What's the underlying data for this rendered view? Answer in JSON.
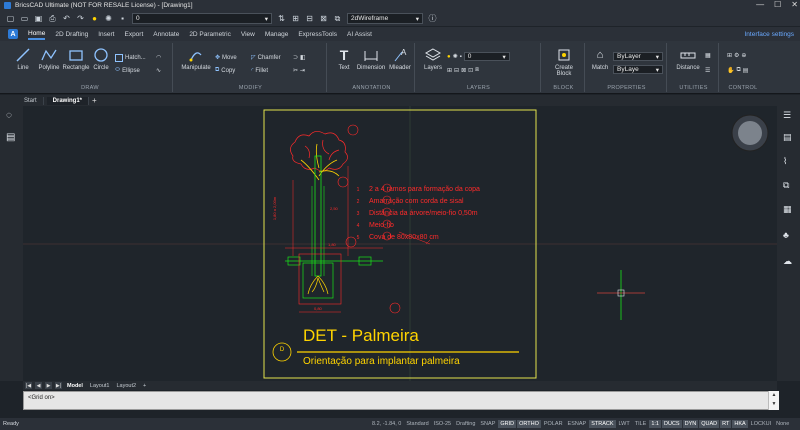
{
  "window": {
    "title": "BricsCAD Ultimate (NOT FOR RESALE License) - [Drawing1]",
    "controls": [
      "—",
      "☐",
      "✕"
    ]
  },
  "qat": {
    "layer_value": "0",
    "visual_style": "2dWireframe"
  },
  "tabs": [
    "Home",
    "2D Drafting",
    "Insert",
    "Export",
    "Annotate",
    "2D Parametric",
    "View",
    "Manage",
    "ExpressTools",
    "AI Assist"
  ],
  "interface_settings": "Interface settings",
  "ribbon": {
    "draw": {
      "title": "DRAW",
      "line": "Line",
      "polyline": "Polyline",
      "rectangle": "Rectangle",
      "circle": "Circle",
      "hatch": "Hatch...",
      "ellipse": "Ellipse"
    },
    "modify": {
      "title": "MODIFY",
      "manipulate": "Manipulate",
      "move": "Move",
      "copy": "Copy",
      "chamfer": "Chamfer",
      "fillet": "Fillet"
    },
    "annotation": {
      "title": "ANNOTATION",
      "text": "Text",
      "dimension": "Dimension",
      "mleader": "Mleader"
    },
    "layers": {
      "title": "LAYERS",
      "layers": "Layers",
      "layer_value": "0"
    },
    "block": {
      "title": "BLOCK",
      "create": "Create",
      "block": "Block"
    },
    "properties": {
      "title": "PROPERTIES",
      "match": "Match",
      "color": "ByLayer",
      "linetype": "ByLaye"
    },
    "utilities": {
      "title": "UTILITIES",
      "distance": "Distance"
    },
    "control": {
      "title": "CONTROL"
    }
  },
  "doc_tabs": [
    "Start",
    "Drawing1*"
  ],
  "drawing": {
    "notes": [
      "2 a 4 ramos para formação da copa",
      "Amarração com corda de sisal",
      "Distância da árvore/meio-fio 0,50m",
      "Meio-fio",
      "Cova de 80x80x80 cm"
    ],
    "note_numbers": [
      "1",
      "2",
      "3",
      "4",
      "5"
    ],
    "detail_title": "DET - Palmeira",
    "detail_subtitle": "Orientação para implantar palmeira",
    "detail_badge": "D",
    "dim_labels": [
      "1,80 a 2,00m",
      "2,50",
      "0,80",
      "1,80"
    ]
  },
  "layout_tabs": [
    "Model",
    "Layout1",
    "Layout2",
    "+"
  ],
  "command_line": "<Grid on>",
  "status": {
    "ready": "Ready",
    "coords": "8.2, -1.84, 0",
    "standard": "Standard",
    "iso": "ISO-25",
    "drafting": "Drafting",
    "toggles": [
      "SNAP",
      "GRID",
      "ORTHO",
      "POLAR",
      "ESNAP",
      "STRACK",
      "LWT",
      "TILE",
      "1:1",
      "DUCS",
      "DYN",
      "QUAD",
      "RT",
      "HKA",
      "LOCKUI",
      "None"
    ],
    "toggles_on": [
      "GRID",
      "ORTHO",
      "STRACK",
      "1:1",
      "DUCS",
      "DYN",
      "QUAD",
      "RT",
      "HKA"
    ]
  },
  "colors": {
    "accent": "#4a90e2",
    "red": "#ff2b2b",
    "yellow": "#ffd400",
    "green": "#19e619",
    "frame": "#e3e34d"
  }
}
